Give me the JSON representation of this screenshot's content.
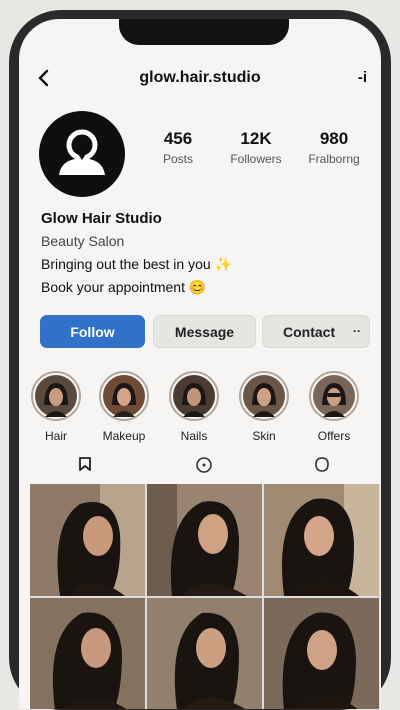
{
  "topbar": {
    "handle": "glow.hair.studio",
    "more": "-i",
    "back_icon": "chevron-left-icon"
  },
  "profile": {
    "avatar_icon": "person-icon"
  },
  "stats": [
    {
      "num": "456",
      "label": "Posts"
    },
    {
      "num": "12K",
      "label": "Followers"
    },
    {
      "num": "980",
      "label": "Fralborng"
    }
  ],
  "bio": {
    "name": "Glow Hair Studio",
    "category": "Beauty Salon",
    "line1": "Bringing out the best in you ✨",
    "line2": "Book your appointment 😊"
  },
  "buttons": {
    "follow": "Follow",
    "message": "Message",
    "contact": "Contact",
    "contact_more": "··"
  },
  "highlights": [
    {
      "label": "Hair"
    },
    {
      "label": "Makeup"
    },
    {
      "label": "Nails"
    },
    {
      "label": "Skin"
    },
    {
      "label": "Offers"
    }
  ],
  "tabs": [
    {
      "icon": "grid-tab-icon"
    },
    {
      "icon": "reels-tab-icon"
    },
    {
      "icon": "tagged-tab-icon"
    }
  ],
  "colors": {
    "follow_button": "#2f72c7",
    "background": "#f6f5f3",
    "text": "#111111"
  }
}
